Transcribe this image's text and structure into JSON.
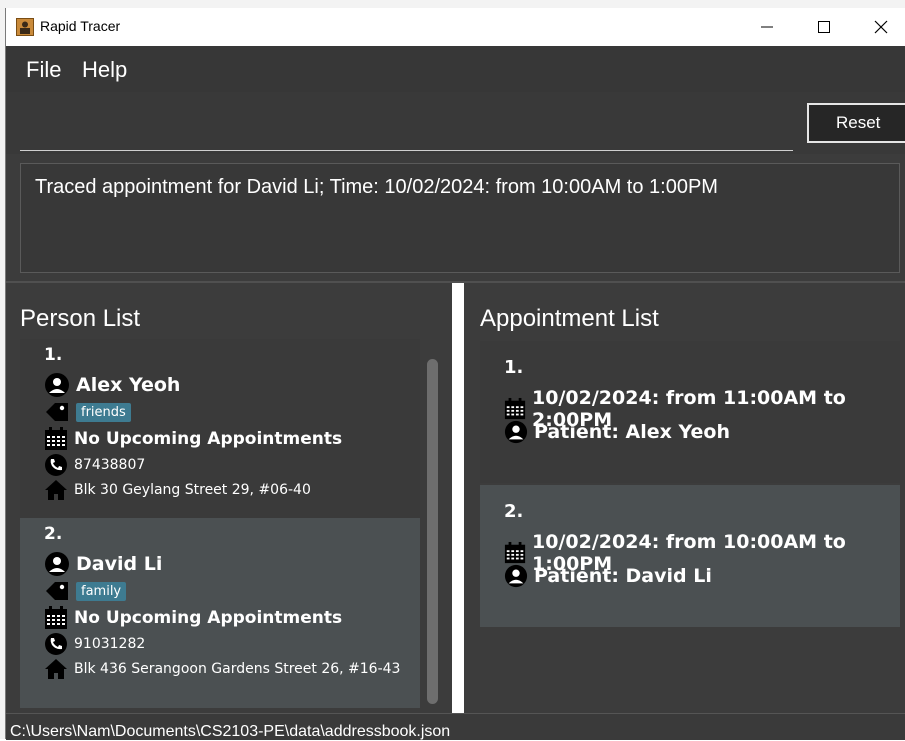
{
  "window": {
    "title": "Rapid Tracer"
  },
  "menu": {
    "file": "File",
    "help": "Help"
  },
  "command": {
    "value": "",
    "reset_label": "Reset"
  },
  "result": {
    "text": "Traced appointment for David Li; Time: 10/02/2024: from 10:00AM to 1:00PM"
  },
  "person_list": {
    "title": "Person List",
    "persons": [
      {
        "index": "1.",
        "name": "Alex Yeoh",
        "tag": "friends",
        "appointment": "No Upcoming Appointments",
        "phone": "87438807",
        "address": "Blk 30 Geylang Street 29, #06-40"
      },
      {
        "index": "2.",
        "name": "David Li",
        "tag": "family",
        "appointment": "No Upcoming Appointments",
        "phone": "91031282",
        "address": "Blk 436 Serangoon Gardens Street 26, #16-43"
      }
    ]
  },
  "appointment_list": {
    "title": "Appointment List",
    "appointments": [
      {
        "index": "1.",
        "time": "10/02/2024: from 11:00AM to 2:00PM",
        "patient": "Patient: Alex Yeoh"
      },
      {
        "index": "2.",
        "time": "10/02/2024: from 10:00AM to 1:00PM",
        "patient": "Patient: David Li"
      }
    ]
  },
  "status": {
    "path": "C:\\Users\\Nam\\Documents\\CS2103-PE\\data\\addressbook.json"
  },
  "colors": {
    "card_dark": "#3a3a3a",
    "card_light": "#4b5052",
    "tag_bg": "#3e7b91"
  }
}
